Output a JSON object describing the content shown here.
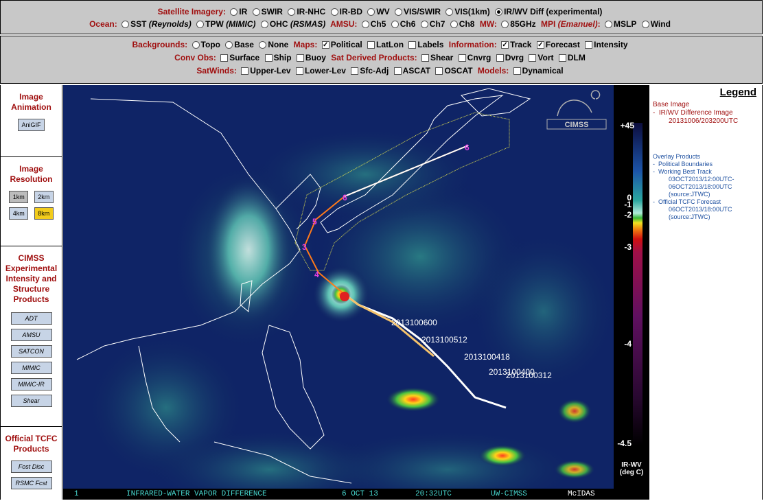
{
  "menu": {
    "row1": {
      "label": "Satellite Imagery:",
      "options": [
        {
          "label": "IR",
          "selected": false
        },
        {
          "label": "SWIR",
          "selected": false
        },
        {
          "label": "IR-NHC",
          "selected": false
        },
        {
          "label": "IR-BD",
          "selected": false
        },
        {
          "label": "WV",
          "selected": false
        },
        {
          "label": "VIS/SWIR",
          "selected": false
        },
        {
          "label": "VIS(1km)",
          "selected": false
        },
        {
          "label": "IR/WV Diff (experimental)",
          "selected": true
        }
      ]
    },
    "row2": {
      "ocean_label": "Ocean:",
      "ocean": [
        {
          "label": "SST",
          "src": "(Reynolds)"
        },
        {
          "label": "TPW",
          "src": "(MIMIC)"
        },
        {
          "label": "OHC",
          "src": "(RSMAS)"
        }
      ],
      "amsu_label": "AMSU:",
      "amsu": [
        "Ch5",
        "Ch6",
        "Ch7",
        "Ch8"
      ],
      "mw_label": "MW:",
      "mw": [
        "85GHz"
      ],
      "mpi_label": "MPI",
      "mpi_src": "(Emanuel)",
      "mpi_suffix": ":",
      "mpi": [
        "MSLP",
        "Wind"
      ]
    },
    "row3": {
      "bg_label": "Backgrounds:",
      "bg": [
        "Topo",
        "Base",
        "None"
      ],
      "maps_label": "Maps:",
      "maps": [
        {
          "label": "Political",
          "checked": true
        },
        {
          "label": "LatLon",
          "checked": false
        },
        {
          "label": "Labels",
          "checked": false
        }
      ],
      "info_label": "Information:",
      "info": [
        {
          "label": "Track",
          "checked": true
        },
        {
          "label": "Forecast",
          "checked": true
        },
        {
          "label": "Intensity",
          "checked": false
        }
      ]
    },
    "row4": {
      "conv_label": "Conv Obs:",
      "conv": [
        "Surface",
        "Ship",
        "Buoy"
      ],
      "sat_label": "Sat Derived Products:",
      "sat": [
        "Shear",
        "Cnvrg",
        "Dvrg",
        "Vort",
        "DLM"
      ]
    },
    "row5": {
      "winds_label": "SatWinds:",
      "winds": [
        "Upper-Lev",
        "Lower-Lev",
        "Sfc-Adj",
        "ASCAT",
        "OSCAT"
      ],
      "models_label": "Models:",
      "models": [
        "Dynamical"
      ]
    }
  },
  "sidebar": {
    "animation": {
      "title": "Image Animation",
      "button": "AniGIF"
    },
    "resolution": {
      "title": "Image Resolution",
      "buttons": [
        "1km",
        "2km",
        "4km",
        "8km"
      ],
      "selected": "8km"
    },
    "products": {
      "title": "CIMSS Experimental Intensity and Structure Products",
      "buttons": [
        "ADT",
        "AMSU",
        "SATCON",
        "MIMIC",
        "MIMIC-IR",
        "Shear"
      ]
    },
    "tcfc": {
      "title": "Official TCFC Products",
      "buttons": [
        "Fost Disc",
        "RSMC Fcst"
      ]
    }
  },
  "map": {
    "logo_text": "CIMSS",
    "track_labels": [
      "2013100600",
      "2013100512",
      "2013100418",
      "2013100400",
      "2013100312"
    ],
    "forecast_markers": [
      "4",
      "3",
      "5",
      "6",
      "6"
    ],
    "footer": {
      "frame": "1",
      "product": "INFRARED-WATER VAPOR DIFFERENCE",
      "date": "6 OCT 13",
      "time": "20:32UTC",
      "source": "UW-CIMSS",
      "software": "McIDAS"
    }
  },
  "scale": {
    "ticks": [
      "+45",
      "0",
      "-1",
      "-2",
      "-3",
      "-4",
      "-4.5"
    ],
    "unit_line1": "IR-WV",
    "unit_line2": "(deg C)"
  },
  "legend": {
    "title": "Legend",
    "base_title": "Base Image",
    "base_item": "IR/WV Difference Image",
    "base_time": "20131006/203200UTC",
    "overlay_title": "Overlay Products",
    "overlay_items": [
      {
        "label": "Political Boundaries"
      },
      {
        "label": "Working Best Track",
        "detail": [
          "03OCT2013/12:00UTC-",
          "06OCT2013/18:00UTC",
          "(source:JTWC)"
        ]
      },
      {
        "label": "Official TCFC Forecast",
        "detail": [
          "06OCT2013/18:00UTC",
          "(source:JTWC)"
        ]
      }
    ]
  },
  "colors": {
    "category": "#a01010",
    "legend_blue": "#1e50a0",
    "ocean": "#0d1e5c",
    "selected_button": "#f2cc1c"
  }
}
